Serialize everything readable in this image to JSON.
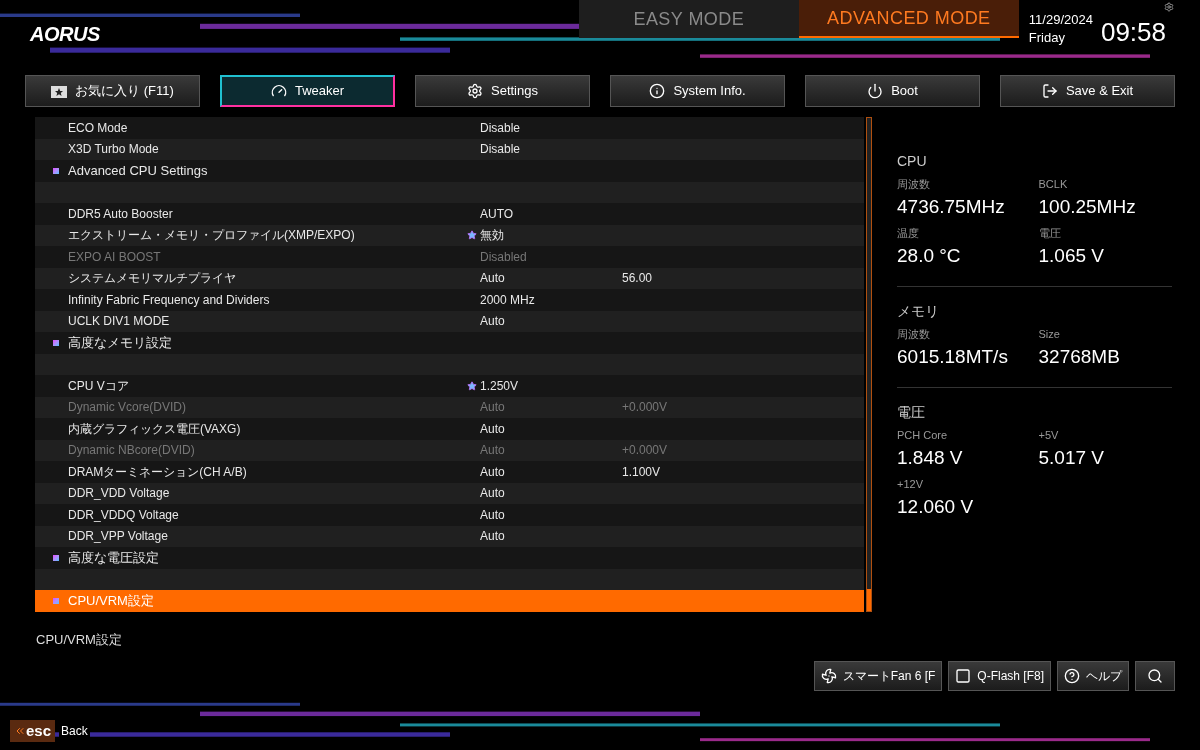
{
  "header": {
    "logo": "AORUS",
    "modes": [
      {
        "label": "EASY MODE",
        "selected": false
      },
      {
        "label": "ADVANCED MODE",
        "selected": true
      }
    ],
    "date": "11/29/2024",
    "day": "Friday",
    "time": "09:58"
  },
  "tabs": [
    {
      "label": "お気に入り (F11)",
      "selected": false
    },
    {
      "label": "Tweaker",
      "selected": true
    },
    {
      "label": "Settings",
      "selected": false
    },
    {
      "label": "System Info.",
      "selected": false
    },
    {
      "label": "Boot",
      "selected": false
    },
    {
      "label": "Save & Exit",
      "selected": false
    }
  ],
  "settings": [
    {
      "kind": "setting",
      "name": "ECO Mode",
      "value": "Disable",
      "disabled": false,
      "starred": false,
      "selected": false
    },
    {
      "kind": "setting",
      "name": "X3D Turbo Mode",
      "value": "Disable",
      "disabled": false,
      "starred": false,
      "selected": false
    },
    {
      "kind": "section",
      "name": "Advanced CPU Settings",
      "selected": false
    },
    {
      "kind": "blank"
    },
    {
      "kind": "setting",
      "name": "DDR5 Auto Booster",
      "value": "AUTO",
      "disabled": false,
      "starred": false,
      "selected": false
    },
    {
      "kind": "setting",
      "name": "エクストリーム・メモリ・プロファイル(XMP/EXPO)",
      "value": "無効",
      "disabled": false,
      "starred": true,
      "selected": false
    },
    {
      "kind": "setting",
      "name": "EXPO AI BOOST",
      "value": "Disabled",
      "disabled": true,
      "starred": false,
      "selected": false
    },
    {
      "kind": "setting",
      "name": "システムメモリマルチプライヤ",
      "value": "Auto",
      "current": "56.00",
      "disabled": false,
      "starred": false,
      "selected": false
    },
    {
      "kind": "setting",
      "name": "Infinity Fabric Frequency and Dividers",
      "value": "2000 MHz",
      "disabled": false,
      "starred": false,
      "selected": false
    },
    {
      "kind": "setting",
      "name": "UCLK DIV1 MODE",
      "value": "Auto",
      "disabled": false,
      "starred": false,
      "selected": false
    },
    {
      "kind": "section",
      "name": "高度なメモリ設定",
      "selected": false
    },
    {
      "kind": "blank"
    },
    {
      "kind": "setting",
      "name": "CPU Vコア",
      "value": "1.250V",
      "disabled": false,
      "starred": true,
      "selected": false
    },
    {
      "kind": "setting",
      "name": "Dynamic Vcore(DVID)",
      "value": "Auto",
      "current": "+0.000V",
      "disabled": true,
      "starred": false,
      "selected": false
    },
    {
      "kind": "setting",
      "name": "内蔵グラフィックス電圧(VAXG)",
      "value": "Auto",
      "disabled": false,
      "starred": false,
      "selected": false
    },
    {
      "kind": "setting",
      "name": "Dynamic NBcore(DVID)",
      "value": "Auto",
      "current": "+0.000V",
      "disabled": true,
      "starred": false,
      "selected": false
    },
    {
      "kind": "setting",
      "name": "DRAMターミネーション(CH A/B)",
      "value": "Auto",
      "current": "1.100V",
      "disabled": false,
      "starred": false,
      "selected": false
    },
    {
      "kind": "setting",
      "name": "DDR_VDD Voltage",
      "value": "Auto",
      "disabled": false,
      "starred": false,
      "selected": false
    },
    {
      "kind": "setting",
      "name": "DDR_VDDQ Voltage",
      "value": "Auto",
      "disabled": false,
      "starred": false,
      "selected": false
    },
    {
      "kind": "setting",
      "name": "DDR_VPP Voltage",
      "value": "Auto",
      "disabled": false,
      "starred": false,
      "selected": false
    },
    {
      "kind": "section",
      "name": "高度な電圧設定",
      "selected": false
    },
    {
      "kind": "blank"
    },
    {
      "kind": "section",
      "name": "CPU/VRM設定",
      "selected": true
    }
  ],
  "description": "CPU/VRM設定",
  "monitor": [
    {
      "title": "CPU",
      "items": [
        {
          "label": "周波数",
          "value": "4736.75MHz"
        },
        {
          "label": "BCLK",
          "value": "100.25MHz"
        },
        {
          "label": "温度",
          "value": "28.0 °C"
        },
        {
          "label": "電圧",
          "value": "1.065 V"
        }
      ]
    },
    {
      "title": "メモリ",
      "items": [
        {
          "label": "周波数",
          "value": "6015.18MT/s"
        },
        {
          "label": "Size",
          "value": "32768MB"
        }
      ]
    },
    {
      "title": "電圧",
      "items": [
        {
          "label": "PCH Core",
          "value": "1.848 V"
        },
        {
          "label": "+5V",
          "value": "5.017 V"
        },
        {
          "label": "+12V",
          "value": "12.060 V"
        }
      ]
    }
  ],
  "tools": [
    "スマートFan 6 [F",
    "Q-Flash [F8]",
    "ヘルプ"
  ],
  "back": {
    "key": "esc",
    "label": "Back"
  }
}
